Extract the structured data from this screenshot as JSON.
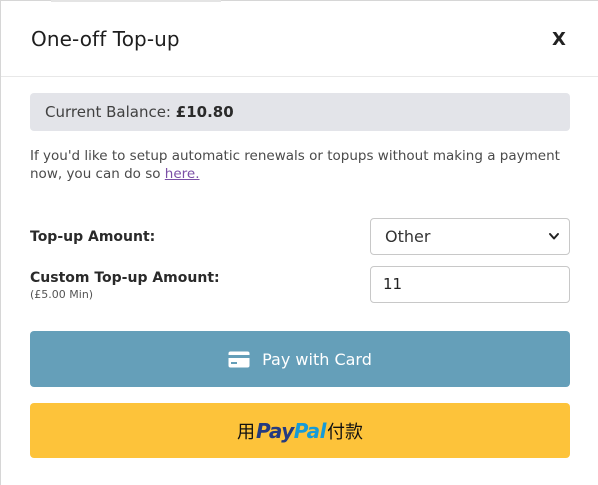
{
  "dialog": {
    "title": "One-off Top-up",
    "close_label": "X"
  },
  "balance": {
    "label": "Current Balance:",
    "value": "£10.80"
  },
  "info": {
    "text": "If you'd like to setup automatic renewals or topups without making a payment now, you can do so ",
    "link_text": "here."
  },
  "form": {
    "topup_label": "Top-up Amount:",
    "topup_selected": "Other",
    "custom_label": "Custom Top-up Amount:",
    "custom_min": "(£5.00 Min)",
    "custom_value": "11"
  },
  "buttons": {
    "card_label": "Pay with Card",
    "paypal_prefix": "用",
    "paypal_logo_pay": "Pay",
    "paypal_logo_pal": "Pal",
    "paypal_suffix": "付款"
  },
  "colors": {
    "card_button": "#659fb9",
    "paypal_button": "#fdc33a",
    "balance_bg": "#e3e4e9",
    "link": "#7b4fa6"
  },
  "icons": {
    "close": "close-icon",
    "select": "chevron-down-icon",
    "card": "credit-card-icon"
  }
}
